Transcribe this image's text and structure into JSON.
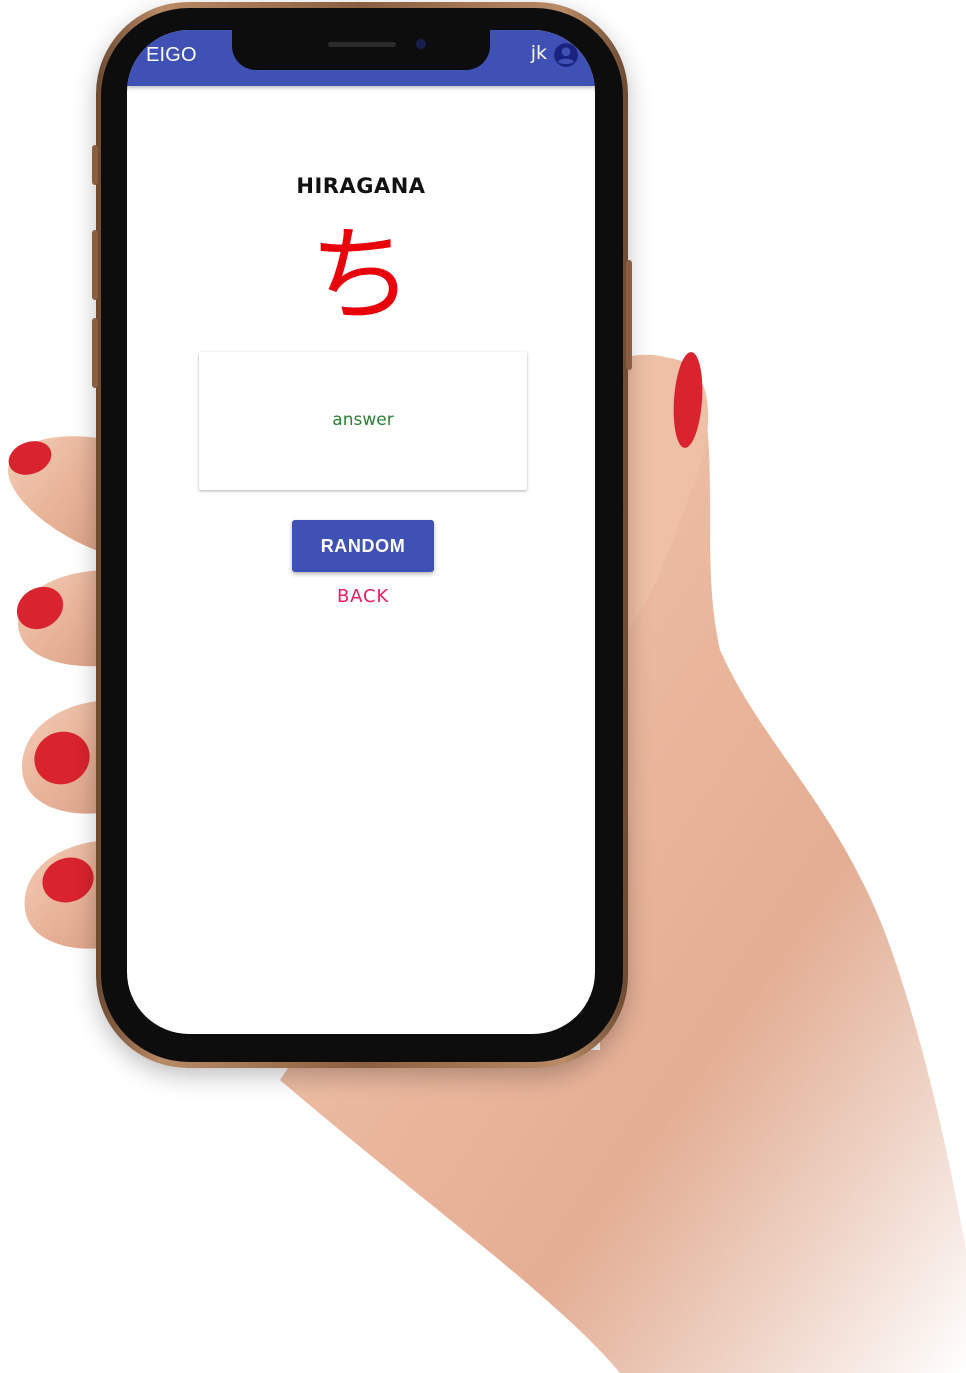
{
  "appbar": {
    "title": "EIGO",
    "user": "jk",
    "account_icon": "account-circle-icon"
  },
  "card": {
    "heading": "HIRAGANA",
    "character": "ち",
    "answer_placeholder": "answer"
  },
  "actions": {
    "random_label": "RANDOM",
    "back_label": "BACK"
  },
  "colors": {
    "primary": "#3f51b5",
    "character": "#e8000b",
    "answer": "#2e7d32",
    "back": "#e91e63"
  }
}
